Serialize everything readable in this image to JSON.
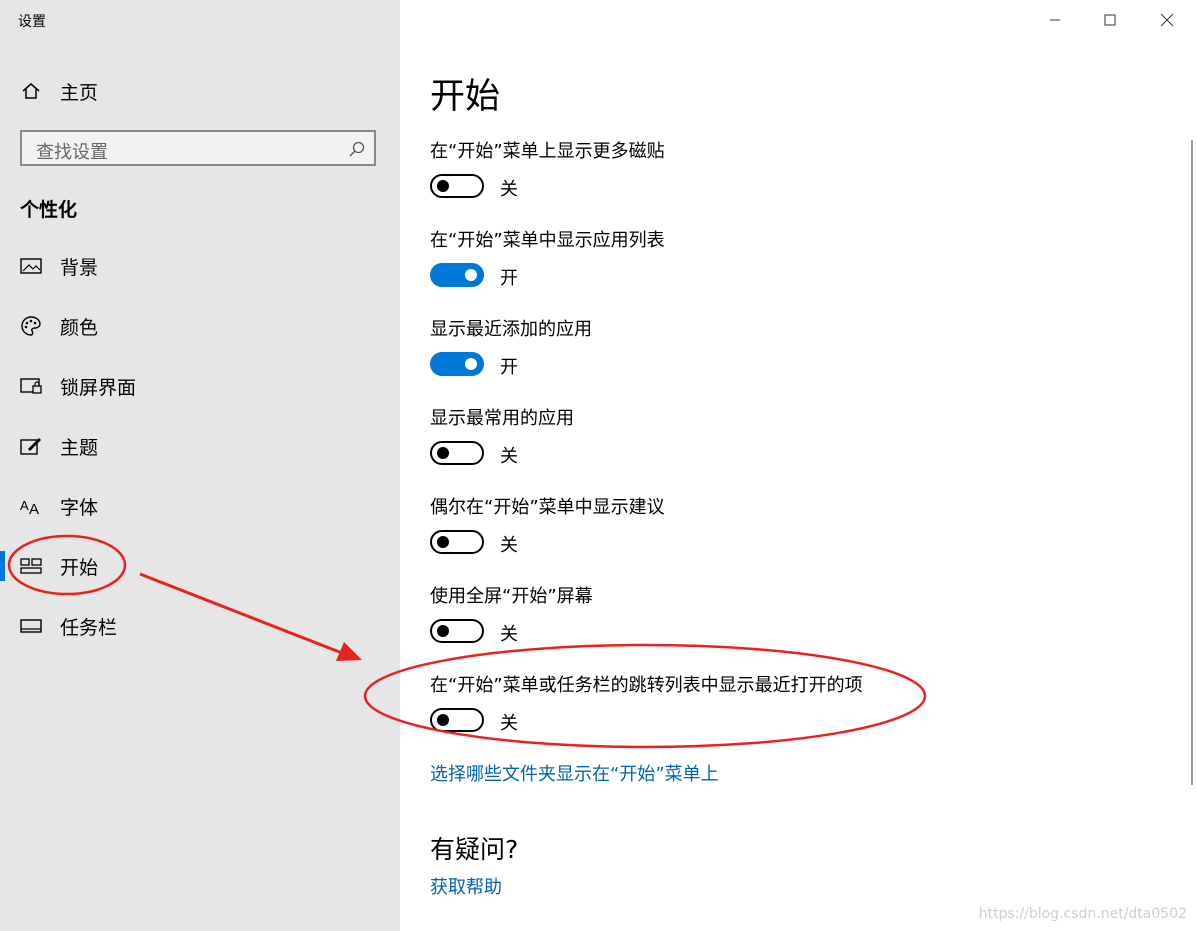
{
  "window": {
    "title": "设置"
  },
  "sidebar": {
    "home": "主页",
    "search_placeholder": "查找设置",
    "section": "个性化",
    "items": [
      {
        "label": "背景",
        "icon": "picture-icon"
      },
      {
        "label": "颜色",
        "icon": "palette-icon"
      },
      {
        "label": "锁屏界面",
        "icon": "lock-screen-icon"
      },
      {
        "label": "主题",
        "icon": "theme-icon"
      },
      {
        "label": "字体",
        "icon": "font-icon"
      },
      {
        "label": "开始",
        "icon": "start-icon",
        "selected": true
      },
      {
        "label": "任务栏",
        "icon": "taskbar-icon"
      }
    ]
  },
  "main": {
    "title": "开始",
    "settings": [
      {
        "label": "在“开始”菜单上显示更多磁贴",
        "on": false,
        "state": "关"
      },
      {
        "label": "在“开始”菜单中显示应用列表",
        "on": true,
        "state": "开"
      },
      {
        "label": "显示最近添加的应用",
        "on": true,
        "state": "开"
      },
      {
        "label": "显示最常用的应用",
        "on": false,
        "state": "关"
      },
      {
        "label": "偶尔在“开始”菜单中显示建议",
        "on": false,
        "state": "关"
      },
      {
        "label": "使用全屏“开始”屏幕",
        "on": false,
        "state": "关"
      },
      {
        "label": "在“开始”菜单或任务栏的跳转列表中显示最近打开的项",
        "on": false,
        "state": "关"
      }
    ],
    "folders_link": "选择哪些文件夹显示在“开始”菜单上",
    "help_title": "有疑问?",
    "help_link": "获取帮助"
  },
  "watermark": "https://blog.csdn.net/dta0502",
  "colors": {
    "accent": "#0078d7",
    "annotation": "#e8231f"
  }
}
